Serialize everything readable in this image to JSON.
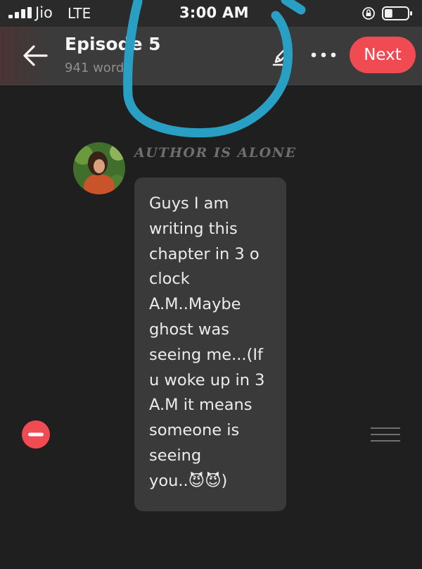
{
  "status_bar": {
    "carrier": "Jio",
    "network": "LTE",
    "time": "3:00 AM",
    "battery_level": 0.35
  },
  "header": {
    "title": "Episode 5",
    "subtitle": "941 words",
    "next_label": "Next"
  },
  "message": {
    "author": "AUTHOR IS ALONE",
    "text": "Guys I am\nwriting this\nchapter in 3 o\nclock\nA.M..Maybe\nghost was\nseeing me...(If\nu woke up in 3\nA.M it means\nsomeone is\nseeing\nyou..😈😈)"
  },
  "colors": {
    "accent": "#f04a52",
    "scribble": "#2a9fc4",
    "background": "#1f1f1f",
    "bubble": "#3a3a3a"
  },
  "icons": [
    "signal-icon",
    "orientation-lock-icon",
    "battery-icon",
    "back-arrow-icon",
    "edit-pencil-icon",
    "more-icon",
    "remove-icon",
    "drag-handle-icon"
  ]
}
